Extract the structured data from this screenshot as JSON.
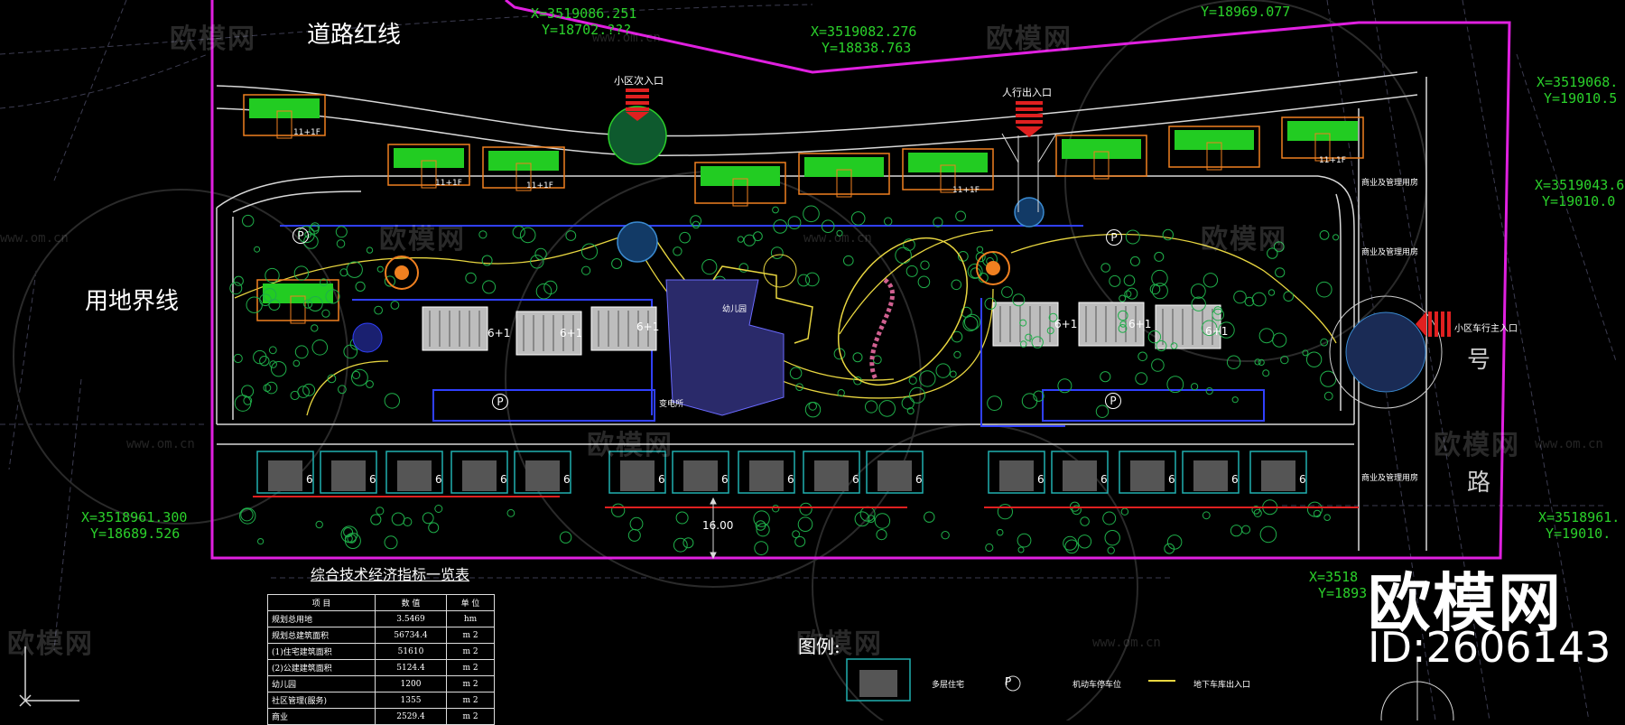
{
  "labels": {
    "road_red_line": "道路红线",
    "land_boundary": "用地界线",
    "entrance_north": "小区次入口",
    "entrance_pedestrian": "人行出入口",
    "entrance_east": "小区车行主入口",
    "kindergarten": "幼儿园",
    "transformer": "变电所",
    "road_char_hao": "号",
    "road_char_lu": "路",
    "dimension": "16.00",
    "legend_title": "图例:",
    "legend_items": [
      "多层住宅",
      "机动车停车位",
      "地下车库出入口"
    ],
    "commercial": [
      "商业及管理用房",
      "商业及管理用房",
      "商业及管理用房"
    ],
    "floor_marks": [
      "11+1F",
      "11+1F",
      "11+1F",
      "11+1F",
      "11+1F"
    ],
    "block_marks": [
      "6+1",
      "6+1",
      "6+1",
      "6+1",
      "6+1",
      "6+1"
    ],
    "parking_symbol": "P"
  },
  "coords": [
    {
      "x": "X=3519086.251",
      "y": "Y=18702.???"
    },
    {
      "x": "X=3519082.276",
      "y": "Y=18838.763"
    },
    {
      "x": "",
      "y": "Y=18969.077"
    },
    {
      "x": "X=3519068.",
      "y": "Y=19010.5"
    },
    {
      "x": "X=3519043.6",
      "y": "Y=19010.0"
    },
    {
      "x": "X=3518961.300",
      "y": "Y=18689.526"
    },
    {
      "x": "X=3518961.",
      "y": "Y=19010."
    },
    {
      "x": "X=3518",
      "y": "Y=1893"
    }
  ],
  "table": {
    "title": "综合技术经济指标一览表",
    "headers": [
      "项 目",
      "数 值",
      "单 位"
    ],
    "rows": [
      [
        "规划总用地",
        "3.5469",
        "hm"
      ],
      [
        "规划总建筑面积",
        "56734.4",
        "m 2"
      ],
      [
        "(1)住宅建筑面积",
        "51610",
        "m 2"
      ],
      [
        "(2)公建建筑面积",
        "5124.4",
        "m 2"
      ],
      [
        "幼儿园",
        "1200",
        "m 2"
      ],
      [
        "社区管理(服务)",
        "1355",
        "m 2"
      ],
      [
        "商业",
        "2529.4",
        "m 2"
      ]
    ]
  },
  "watermark": {
    "brand": "欧模网",
    "url": "www.om.cn",
    "big_brand": "欧模网",
    "id": "ID:2606143"
  },
  "colors": {
    "boundary": "#e020e0",
    "road": "#d8d8d8",
    "building": "#f08020",
    "roof": "#22cc22",
    "tree": "#1fae4a",
    "path": "#e8d640",
    "parking": "#3040ff",
    "coord_text": "#2bd12b",
    "entrance_arrow": "#ff2a2a"
  }
}
